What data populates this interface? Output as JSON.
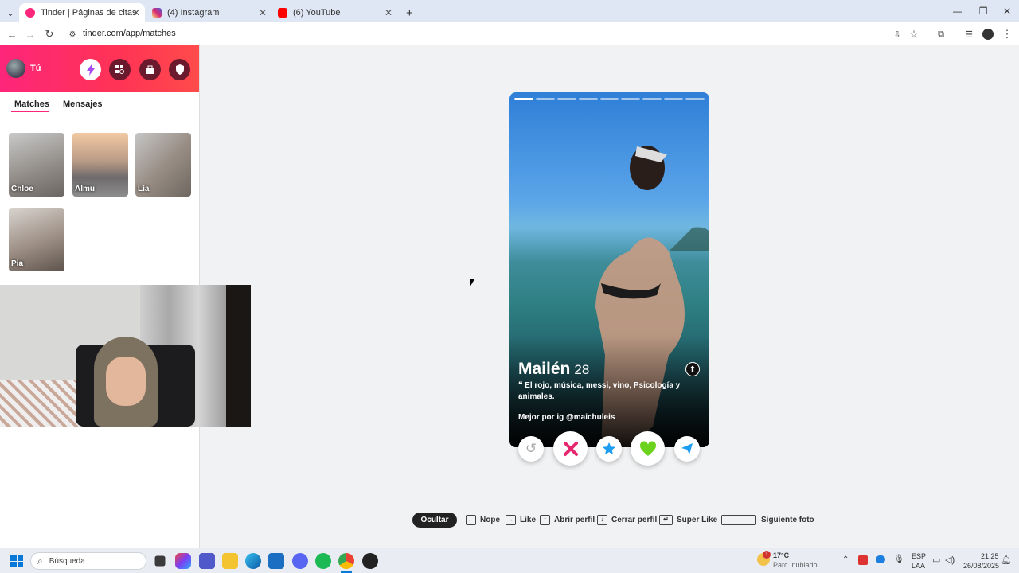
{
  "browser": {
    "tabs": [
      {
        "title": "Tinder | Páginas de citas",
        "color": "#fd267a"
      },
      {
        "title": "(4) Instagram",
        "color": "#d62976"
      },
      {
        "title": "(6) YouTube",
        "color": "#ff0000"
      }
    ],
    "url": "tinder.com/app/matches"
  },
  "sidebar": {
    "user_label": "Tú",
    "tabs": [
      "Matches",
      "Mensajes"
    ],
    "matches": [
      "Chloe",
      "Almu",
      "Lía",
      "Pia"
    ]
  },
  "profile": {
    "name": "Mailén",
    "age": "28",
    "bio": "El rojo, música, messi, vino, Psicología y animales.",
    "extra": "Mejor por ig @maichuleis"
  },
  "shortcuts": {
    "hide": "Ocultar",
    "items": [
      "Nope",
      "Like",
      "Abrir perfil",
      "Cerrar perfil",
      "Super Like",
      "Siguiente foto"
    ]
  },
  "taskbar": {
    "search_placeholder": "Búsqueda",
    "weather_temp": "17°C",
    "weather_desc": "Parc. nublado",
    "weather_badge": "1",
    "lang_top": "ESP",
    "lang_bottom": "LAA",
    "time": "21:25",
    "date": "26/08/2025"
  }
}
